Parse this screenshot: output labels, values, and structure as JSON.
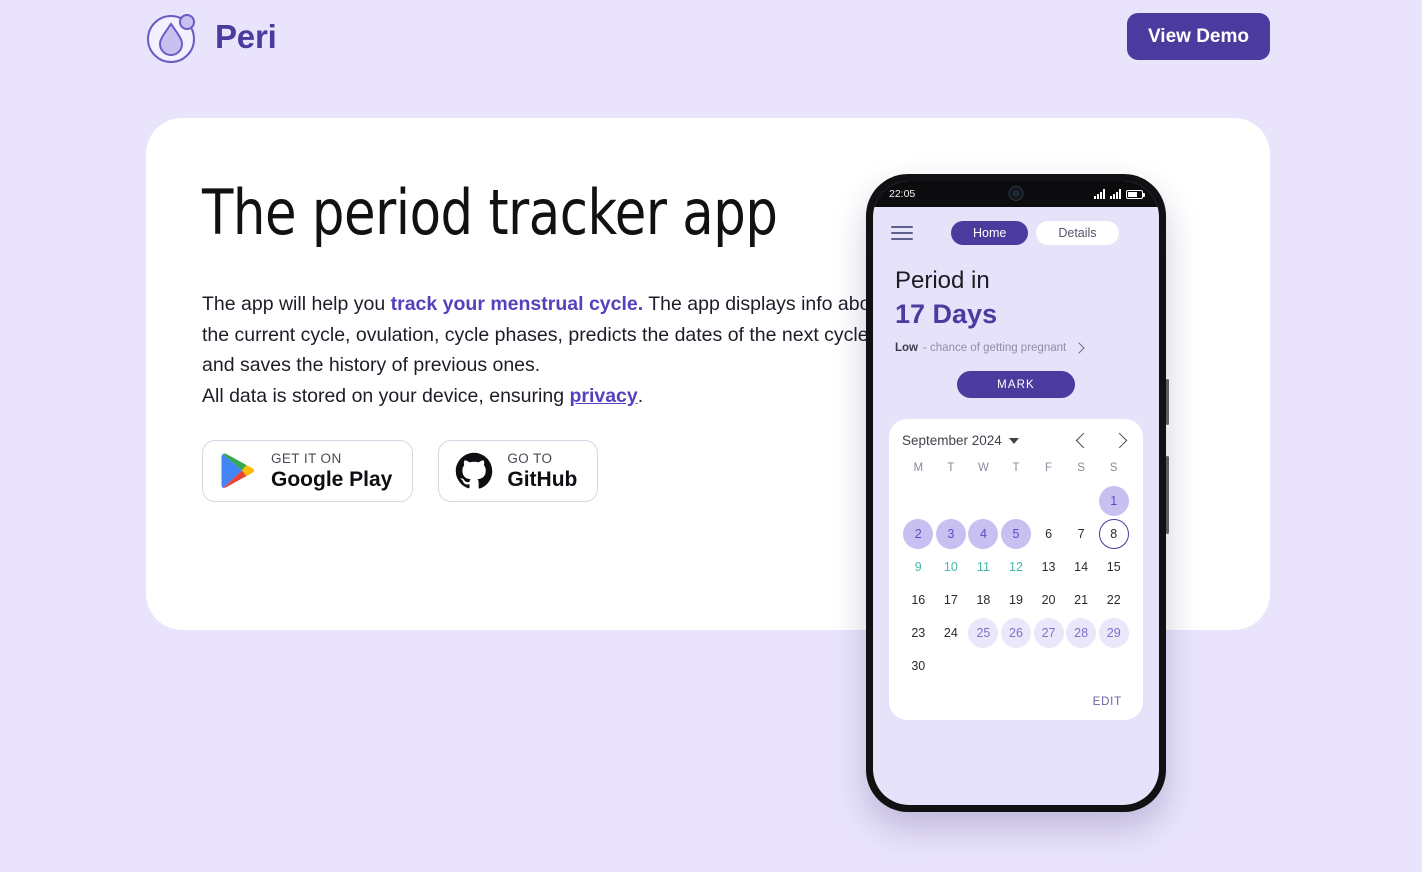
{
  "header": {
    "brand_name": "Peri",
    "logo_icon": "water-drop-logo-icon",
    "cta_label": "View Demo"
  },
  "hero": {
    "title": "The period tracker app",
    "paragraph": {
      "line1_part1": "The app will help you ",
      "line1_highlight": "track your menstrual cycle.",
      "line1_part2": " The app displays info about the current cycle, ovulation, cycle phases, predicts the dates of the next cycles and saves the history of previous ones.",
      "line2_part1": "All data is stored on your device, ensuring ",
      "line2_link": "privacy",
      "line2_part2": "."
    },
    "store_buttons": [
      {
        "icon": "google-play-icon",
        "top_label": "GET IT ON",
        "bottom_label": "Google Play"
      },
      {
        "icon": "github-icon",
        "top_label": "GO TO",
        "bottom_label": "GitHub"
      }
    ]
  },
  "phone": {
    "status_bar": {
      "time": "22:05",
      "icons": [
        "camera-icon",
        "signal-bars-icon",
        "signal-bars-secondary-icon",
        "battery-icon"
      ]
    },
    "nav": {
      "menu_icon": "hamburger-menu-icon",
      "tabs": [
        {
          "label": "Home",
          "active": true
        },
        {
          "label": "Details",
          "active": false
        }
      ]
    },
    "period": {
      "lead": "Period in",
      "days": "17 Days",
      "chance_level": "Low",
      "chance_text": "- chance of getting pregnant",
      "chance_chevron": "chevron-right-icon",
      "mark_label": "MARK"
    },
    "calendar": {
      "month_label": "September 2024",
      "month_caret": "caret-down-icon",
      "prev_icon": "chevron-left-icon",
      "next_icon": "chevron-right-icon",
      "weekdays": [
        "M",
        "T",
        "W",
        "T",
        "F",
        "S",
        "S"
      ],
      "leading_blanks": 6,
      "days": [
        {
          "n": "1",
          "state": "period"
        },
        {
          "n": "2",
          "state": "period"
        },
        {
          "n": "3",
          "state": "period"
        },
        {
          "n": "4",
          "state": "period"
        },
        {
          "n": "5",
          "state": "period"
        },
        {
          "n": "6",
          "state": ""
        },
        {
          "n": "7",
          "state": ""
        },
        {
          "n": "8",
          "state": "today"
        },
        {
          "n": "9",
          "state": "ovulation"
        },
        {
          "n": "10",
          "state": "ovulation"
        },
        {
          "n": "11",
          "state": "ovulation"
        },
        {
          "n": "12",
          "state": "ovulation"
        },
        {
          "n": "13",
          "state": ""
        },
        {
          "n": "14",
          "state": ""
        },
        {
          "n": "15",
          "state": ""
        },
        {
          "n": "16",
          "state": ""
        },
        {
          "n": "17",
          "state": ""
        },
        {
          "n": "18",
          "state": ""
        },
        {
          "n": "19",
          "state": ""
        },
        {
          "n": "20",
          "state": ""
        },
        {
          "n": "21",
          "state": ""
        },
        {
          "n": "22",
          "state": ""
        },
        {
          "n": "23",
          "state": ""
        },
        {
          "n": "24",
          "state": ""
        },
        {
          "n": "25",
          "state": "predicted"
        },
        {
          "n": "26",
          "state": "predicted"
        },
        {
          "n": "27",
          "state": "predicted"
        },
        {
          "n": "28",
          "state": "predicted"
        },
        {
          "n": "29",
          "state": "predicted"
        },
        {
          "n": "30",
          "state": ""
        }
      ],
      "edit_label": "EDIT"
    }
  },
  "colors": {
    "page_background": "#e9e4fc",
    "brand_purple": "#4b3b9e",
    "accent_link": "#5442bd",
    "period_fill": "#c9c0f2",
    "predicted_fill": "#ebe7fb",
    "ovulation_text": "#46b9a8",
    "card_white": "#ffffff"
  }
}
